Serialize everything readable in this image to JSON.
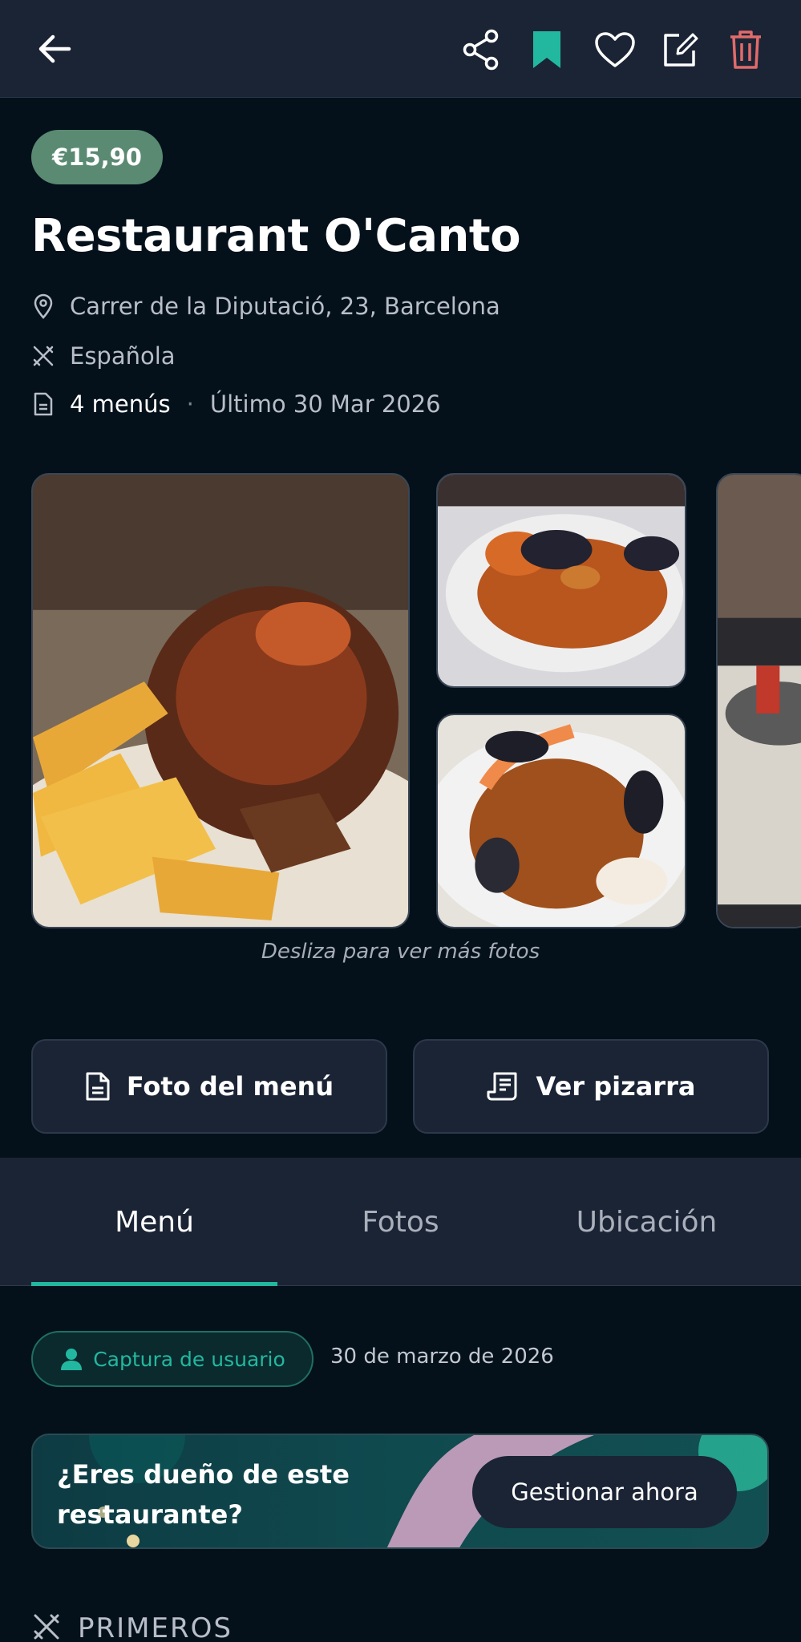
{
  "header": {
    "back_icon": "arrow-left-icon",
    "actions": [
      "share-icon",
      "bookmark-icon",
      "heart-icon",
      "edit-icon",
      "trash-icon"
    ],
    "colors": {
      "bookmark": "#22b8a0",
      "trash": "#e06b6b"
    }
  },
  "restaurant": {
    "price": "€15,90",
    "name": "Restaurant O'Canto",
    "address": "Carrer de la Diputació, 23, Barcelona",
    "cuisine": "Española",
    "menus_count": "4 menús",
    "last_update": "Último 30 Mar 2026"
  },
  "gallery": {
    "hint": "Desliza para ver más fotos"
  },
  "actions": {
    "menu_photo": "Foto del menú",
    "board": "Ver pizarra"
  },
  "tabs": {
    "items": [
      "Menú",
      "Fotos",
      "Ubicación"
    ],
    "active": "Menú"
  },
  "source": {
    "chip_label": "Captura de usuario",
    "date": "30 de marzo de 2026"
  },
  "owner_banner": {
    "text": "¿Eres dueño de este restaurante?",
    "cta": "Gestionar ahora"
  },
  "section": {
    "title": "PRIMEROS"
  },
  "colors": {
    "accent": "#22b8a0",
    "background": "#04111b",
    "surface": "#1b2435",
    "price_badge": "#5a8a72"
  }
}
